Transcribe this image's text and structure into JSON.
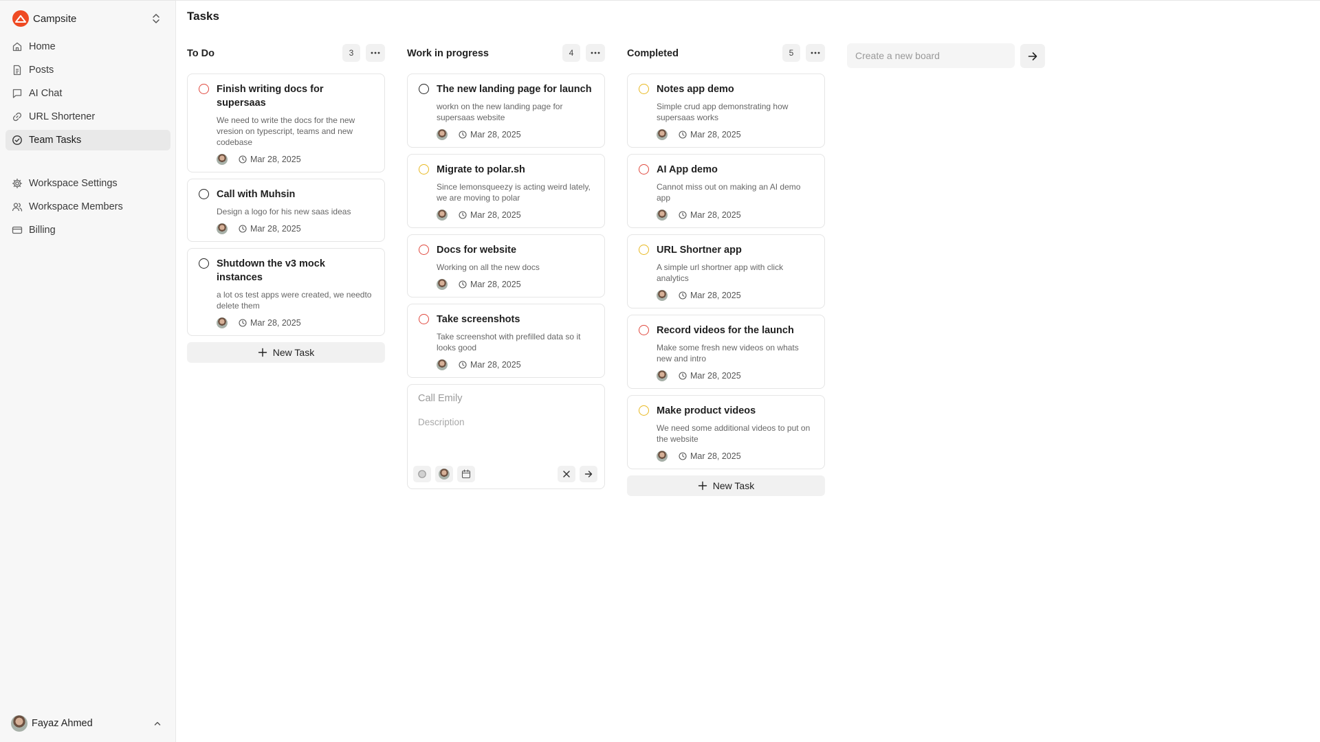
{
  "app": {
    "org_name": "Campsite",
    "page_title": "Tasks",
    "brand_color": "#ef4a23"
  },
  "sidebar": {
    "items": [
      {
        "label": "Home",
        "icon": "home-icon"
      },
      {
        "label": "Posts",
        "icon": "document-icon"
      },
      {
        "label": "AI Chat",
        "icon": "chat-icon"
      },
      {
        "label": "URL Shortener",
        "icon": "link-icon"
      },
      {
        "label": "Team Tasks",
        "icon": "check-circle-icon",
        "active": true
      }
    ],
    "settings_items": [
      {
        "label": "Workspace Settings",
        "icon": "gear-icon"
      },
      {
        "label": "Workspace Members",
        "icon": "users-icon"
      },
      {
        "label": "Billing",
        "icon": "credit-card-icon"
      }
    ],
    "user_name": "Fayaz Ahmed"
  },
  "columns": [
    {
      "title": "To Do",
      "count": "3",
      "cards": [
        {
          "title": "Finish writing docs for supersaas",
          "description": "We need to write the docs for the new vresion on typescript, teams and new codebase",
          "date": "Mar 28, 2025",
          "status_color": "red"
        },
        {
          "title": "Call with Muhsin",
          "description": "Design a logo for his new saas ideas",
          "date": "Mar 28, 2025",
          "status_color": "black"
        },
        {
          "title": "Shutdown the v3 mock instances",
          "description": "a lot os test apps were created, we needto delete them",
          "date": "Mar 28, 2025",
          "status_color": "black"
        }
      ],
      "new_task_label": "New Task"
    },
    {
      "title": "Work in progress",
      "count": "4",
      "cards": [
        {
          "title": "The new landing page for launch",
          "description": "workn on the new landing page for supersaas website",
          "date": "Mar 28, 2025",
          "status_color": "black"
        },
        {
          "title": "Migrate to polar.sh",
          "description": "Since lemonsqueezy is acting weird lately, we are moving to polar",
          "date": "Mar 28, 2025",
          "status_color": "yellow"
        },
        {
          "title": "Docs for website",
          "description": "Working on all the new docs",
          "date": "Mar 28, 2025",
          "status_color": "red"
        },
        {
          "title": "Take screenshots",
          "description": "Take screenshot with prefilled data so it looks good",
          "date": "Mar 28, 2025",
          "status_color": "red"
        }
      ],
      "draft": {
        "title_placeholder": "Call Emily",
        "description_placeholder": "Description"
      }
    },
    {
      "title": "Completed",
      "count": "5",
      "cards": [
        {
          "title": "Notes app demo",
          "description": "Simple crud app demonstrating how supersaas works",
          "date": "Mar 28, 2025",
          "status_color": "yellow"
        },
        {
          "title": "AI App demo",
          "description": "Cannot miss out on making an AI demo app",
          "date": "Mar 28, 2025",
          "status_color": "red"
        },
        {
          "title": "URL Shortner app",
          "description": "A simple url shortner app with click analytics",
          "date": "Mar 28, 2025",
          "status_color": "yellow"
        },
        {
          "title": "Record videos for the launch",
          "description": "Make some fresh new videos on whats new and intro",
          "date": "Mar 28, 2025",
          "status_color": "red"
        },
        {
          "title": "Make product videos",
          "description": "We need some additional videos to put on the website",
          "date": "Mar 28, 2025",
          "status_color": "yellow"
        }
      ],
      "new_task_label": "New Task"
    }
  ],
  "create_board": {
    "placeholder": "Create a new board"
  },
  "status_colors": {
    "red": "#e0483e",
    "yellow": "#e8b820",
    "black": "#222222"
  }
}
